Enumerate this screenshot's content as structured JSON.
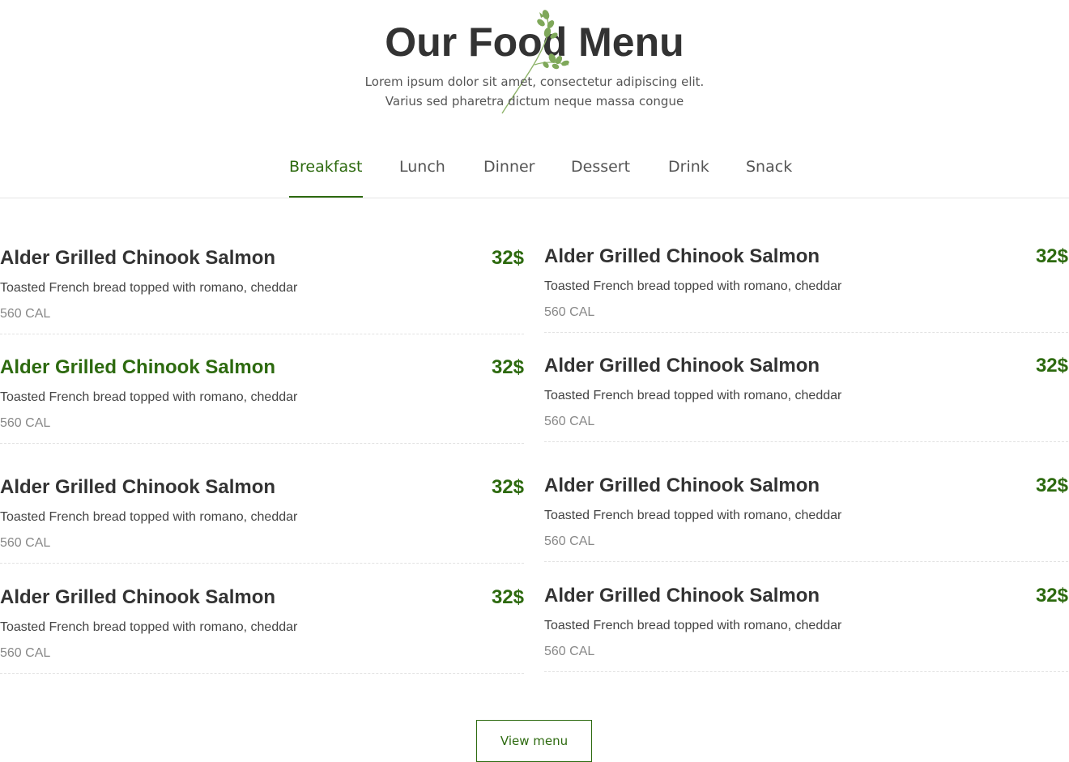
{
  "header": {
    "title": "Our Food Menu",
    "subtitle_line1": "Lorem ipsum dolor sit amet, consectetur adipiscing elit.",
    "subtitle_line2": "Varius sed pharetra dictum neque massa congue"
  },
  "tabs": [
    {
      "label": "Breakfast",
      "active": true
    },
    {
      "label": "Lunch",
      "active": false
    },
    {
      "label": "Dinner",
      "active": false
    },
    {
      "label": "Dessert",
      "active": false
    },
    {
      "label": "Drink",
      "active": false
    },
    {
      "label": "Snack",
      "active": false
    }
  ],
  "menu_items": [
    {
      "name": "Alder Grilled Chinook Salmon",
      "price": "32$",
      "description": "Toasted French bread topped with romano, cheddar",
      "calories": "560 CAL"
    },
    {
      "name": "Alder Grilled Chinook Salmon",
      "price": "32$",
      "description": "Toasted French bread topped with romano, cheddar",
      "calories": "560 CAL"
    },
    {
      "name": "Alder Grilled Chinook Salmon",
      "price": "32$",
      "description": "Toasted French bread topped with romano, cheddar",
      "calories": "560 CAL",
      "highlighted": true
    },
    {
      "name": "Alder Grilled Chinook Salmon",
      "price": "32$",
      "description": "Toasted French bread topped with romano, cheddar",
      "calories": "560 CAL"
    },
    {
      "name": "Alder Grilled Chinook Salmon",
      "price": "32$",
      "description": "Toasted French bread topped with romano, cheddar",
      "calories": "560 CAL"
    },
    {
      "name": "Alder Grilled Chinook Salmon",
      "price": "32$",
      "description": "Toasted French bread topped with romano, cheddar",
      "calories": "560 CAL"
    },
    {
      "name": "Alder Grilled Chinook Salmon",
      "price": "32$",
      "description": "Toasted French bread topped with romano, cheddar",
      "calories": "560 CAL"
    },
    {
      "name": "Alder Grilled Chinook Salmon",
      "price": "32$",
      "description": "Toasted French bread topped with romano, cheddar",
      "calories": "560 CAL"
    }
  ],
  "view_menu_label": "View menu",
  "colors": {
    "accent": "#2d6a0f",
    "text": "#333333",
    "muted": "#888888",
    "divider": "#e4e4e4"
  },
  "icons": {
    "decoration": "herb-sprig-icon"
  }
}
